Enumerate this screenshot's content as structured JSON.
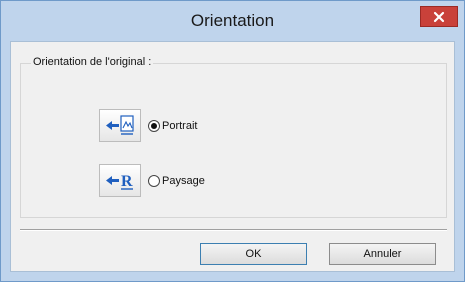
{
  "window": {
    "title": "Orientation",
    "close_icon": "close-icon"
  },
  "group": {
    "label": "Orientation de l'original :"
  },
  "options": [
    {
      "icon": "portrait-orientation-icon",
      "label": "Portrait",
      "selected": true
    },
    {
      "icon": "landscape-orientation-icon",
      "label": "Paysage",
      "selected": false
    }
  ],
  "buttons": {
    "ok_label": "OK",
    "cancel_label": "Annuler"
  },
  "colors": {
    "title_bar": "#bfd4ec",
    "close_button": "#c9413a",
    "client_bg": "#f0f0f0",
    "icon_blue": "#1f5fbf"
  }
}
